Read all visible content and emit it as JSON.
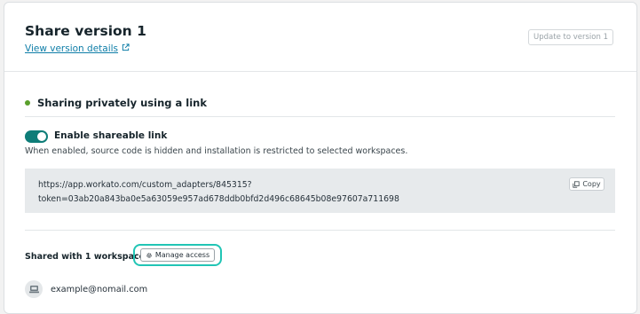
{
  "header": {
    "title": "Share version 1",
    "details_link": "View version details",
    "update_button": "Update to version 1"
  },
  "sharing": {
    "title": "Sharing privately using a link",
    "status_color": "#5aa02c",
    "toggle_label": "Enable shareable link",
    "toggle_on": true,
    "help_text": "When enabled, source code is hidden and installation is restricted to selected workspaces.",
    "link_line1": "https://app.workato.com/custom_adapters/845315?",
    "link_line2": "token=03ab20a843ba0e5a63059e957ad678ddb0bfd2d496c68645b08e97607a711698",
    "copy_button": "Copy"
  },
  "workspaces": {
    "shared_label": "Shared with 1 workspace",
    "manage_button": "Manage access",
    "items": [
      {
        "email": "example@nomail.com",
        "icon": "workspace-icon"
      }
    ]
  },
  "colors": {
    "accent": "#0e7d78",
    "link": "#0f7ea8",
    "highlight": "#21c5b5"
  }
}
